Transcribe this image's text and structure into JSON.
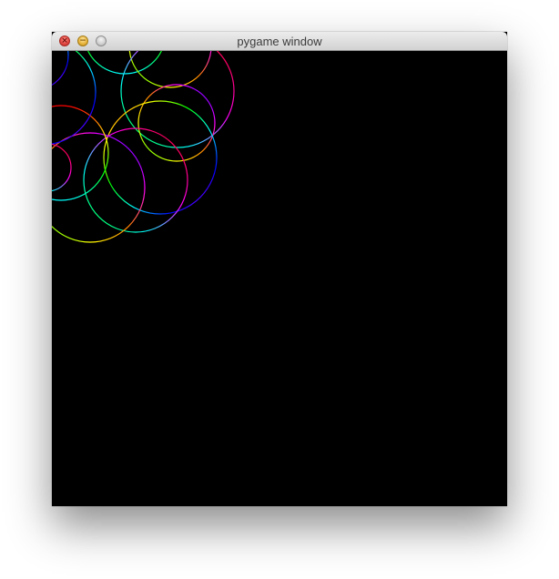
{
  "window": {
    "title": "pygame window",
    "close_glyph": "×",
    "minimize_glyph": "−",
    "zoom_glyph": ""
  },
  "icons": {
    "close": "close-icon",
    "minimize": "minimize-icon",
    "zoom": "zoom-icon"
  },
  "canvas": {
    "background": "#000000",
    "palette": [
      "#ff0000",
      "#ffff00",
      "#00ff00",
      "#00ffff",
      "#0000ff",
      "#ff00ff",
      "#ff8000"
    ]
  }
}
